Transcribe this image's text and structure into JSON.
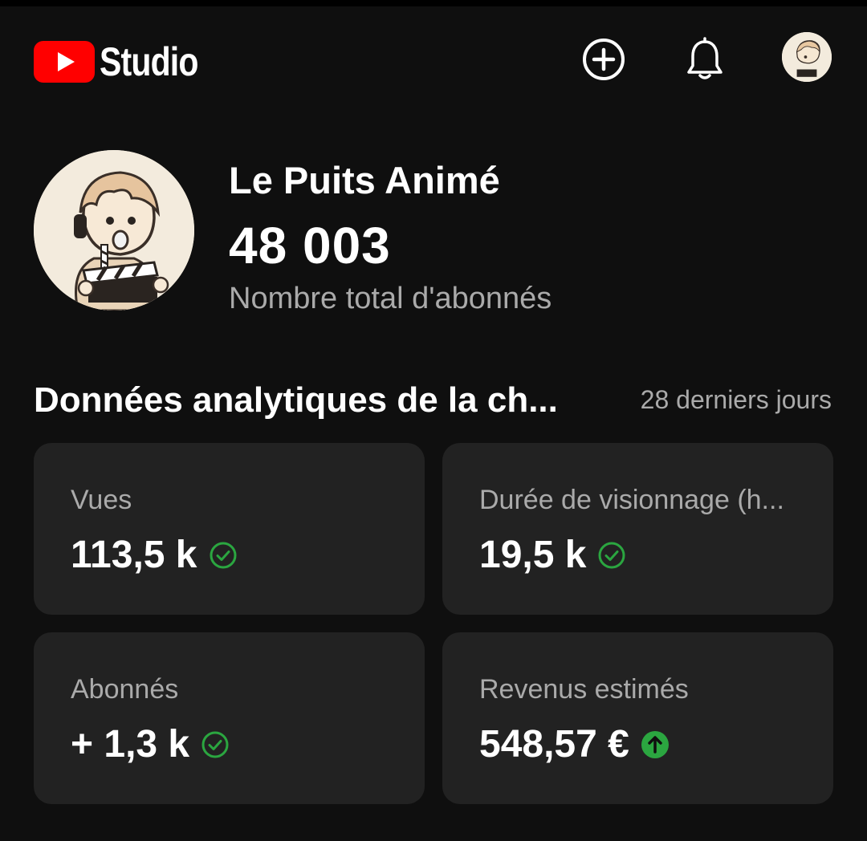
{
  "app": {
    "title": "Studio",
    "brand_red": "#ff0000"
  },
  "header": {
    "create_icon": "create-plus-icon",
    "notifications_icon": "bell-icon",
    "account_icon": "account-avatar"
  },
  "channel": {
    "name": "Le Puits Animé",
    "subscriber_count": "48 003",
    "subscriber_label": "Nombre total d'abonnés"
  },
  "analytics": {
    "title": "Données analytiques de la ch...",
    "period": "28 derniers jours",
    "cards": [
      {
        "label": "Vues",
        "value": "113,5 k",
        "status_icon": "check-circle-icon",
        "status_color": "#2ba640"
      },
      {
        "label": "Durée de visionnage (h...",
        "value": "19,5 k",
        "status_icon": "check-circle-icon",
        "status_color": "#2ba640"
      },
      {
        "label": "Abonnés",
        "value": "+ 1,3 k",
        "status_icon": "check-circle-icon",
        "status_color": "#2ba640"
      },
      {
        "label": "Revenus estimés",
        "value": "548,57 €",
        "status_icon": "arrow-up-circle-icon",
        "status_color": "#2ba640"
      }
    ]
  }
}
